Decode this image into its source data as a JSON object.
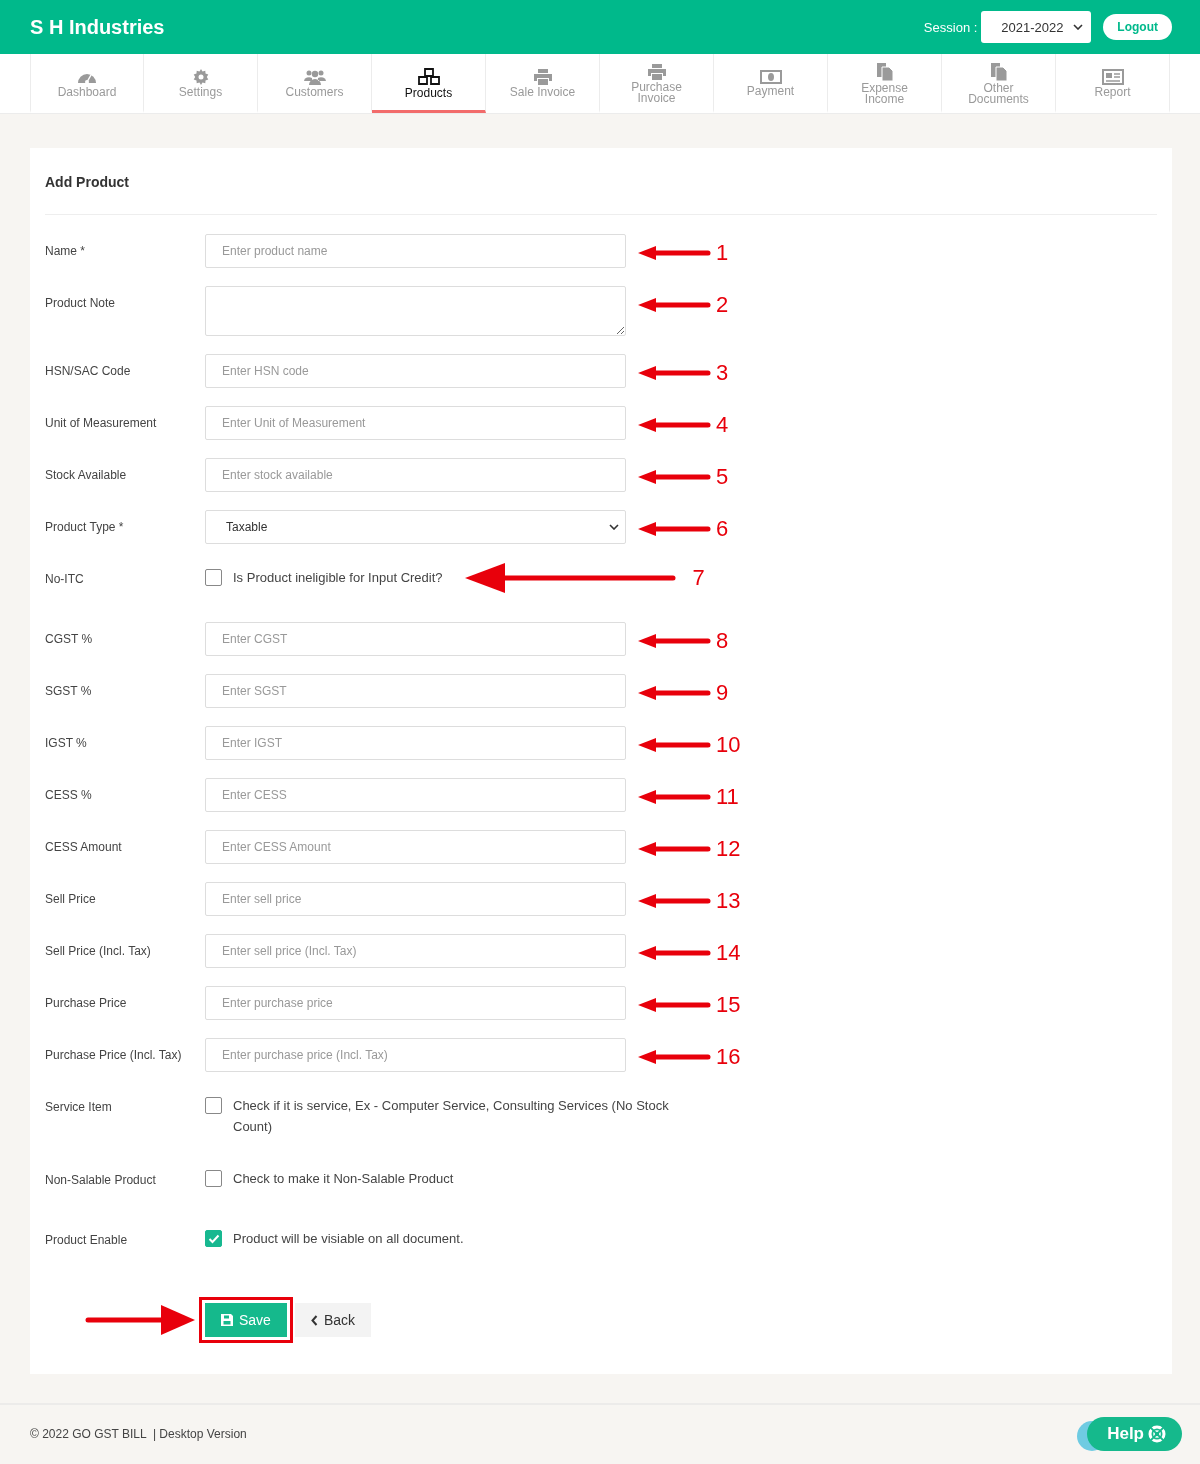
{
  "header": {
    "brand": "S H Industries",
    "session_label": "Session :",
    "session_value": "2021-2022",
    "logout": "Logout"
  },
  "tabs": [
    {
      "label": "Dashboard",
      "kind": "gauge",
      "selected": false
    },
    {
      "label": "Settings",
      "kind": "gear",
      "selected": false
    },
    {
      "label": "Customers",
      "kind": "users",
      "selected": false
    },
    {
      "label": "Products",
      "kind": "boxes",
      "selected": true
    },
    {
      "label": "Sale Invoice",
      "kind": "printer",
      "selected": false
    },
    {
      "label": "Purchase Invoice",
      "kind": "printer",
      "selected": false
    },
    {
      "label": "Payment",
      "kind": "money",
      "selected": false
    },
    {
      "label": "Expense Income",
      "kind": "files",
      "selected": false
    },
    {
      "label": "Other Documents",
      "kind": "files",
      "selected": false
    },
    {
      "label": "Report",
      "kind": "news",
      "selected": false
    }
  ],
  "form": {
    "title": "Add Product",
    "fields": [
      {
        "kind": "text",
        "label": "Name *",
        "placeholder": "Enter product name",
        "annotation": "1"
      },
      {
        "kind": "textarea",
        "label": "Product Note",
        "annotation": "2"
      },
      {
        "kind": "text",
        "label": "HSN/SAC Code",
        "placeholder": "Enter HSN code",
        "annotation": "3"
      },
      {
        "kind": "text",
        "label": "Unit of Measurement",
        "placeholder": "Enter Unit of Measurement",
        "annotation": "4"
      },
      {
        "kind": "text",
        "label": "Stock Available",
        "placeholder": "Enter stock available",
        "annotation": "5"
      },
      {
        "kind": "select",
        "label": "Product Type *",
        "value": "Taxable",
        "annotation": "6"
      },
      {
        "kind": "checkbox",
        "label": "No-ITC",
        "text": "Is Product ineligible for Input Credit?",
        "checked": false,
        "annotation": "7"
      },
      {
        "kind": "text",
        "label": "CGST %",
        "placeholder": "Enter CGST",
        "annotation": "8"
      },
      {
        "kind": "text",
        "label": "SGST %",
        "placeholder": "Enter SGST",
        "annotation": "9"
      },
      {
        "kind": "text",
        "label": "IGST %",
        "placeholder": "Enter IGST",
        "annotation": "10"
      },
      {
        "kind": "text",
        "label": "CESS %",
        "placeholder": "Enter CESS",
        "annotation": "11"
      },
      {
        "kind": "text",
        "label": "CESS Amount",
        "placeholder": "Enter CESS Amount",
        "annotation": "12"
      },
      {
        "kind": "text",
        "label": "Sell Price",
        "placeholder": "Enter sell price",
        "annotation": "13"
      },
      {
        "kind": "text",
        "label": "Sell Price (Incl. Tax)",
        "placeholder": "Enter sell price (Incl. Tax)",
        "annotation": "14"
      },
      {
        "kind": "text",
        "label": "Purchase Price",
        "placeholder": "Enter purchase price",
        "annotation": "15"
      },
      {
        "kind": "text",
        "label": "Purchase Price (Incl. Tax)",
        "placeholder": "Enter purchase price (Incl. Tax)",
        "annotation": "16"
      },
      {
        "kind": "checkbox",
        "label": "Service Item",
        "text": "Check if it is service, Ex - Computer Service, Consulting Services (No Stock Count)",
        "checked": false
      },
      {
        "kind": "checkbox",
        "label": "Non-Salable Product",
        "text": "Check to make it Non-Salable Product",
        "checked": false
      },
      {
        "kind": "checkbox",
        "label": "Product Enable",
        "text": "Product will be visiable on all document.",
        "checked": true
      }
    ],
    "save": "Save",
    "back": "Back"
  },
  "footer": {
    "copyright": "© 2022 GO GST BILL  | Desktop Version",
    "help": "Help"
  }
}
